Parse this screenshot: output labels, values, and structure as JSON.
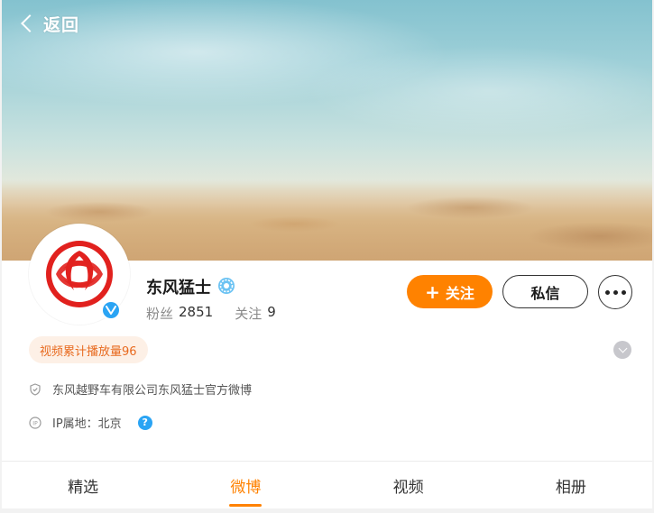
{
  "header": {
    "back_label": "返回"
  },
  "profile": {
    "name": "东风猛士",
    "stats": {
      "followers_label": "粉丝",
      "followers_value": "2851",
      "following_label": "关注",
      "following_value": "9"
    },
    "verified_mark": "V"
  },
  "actions": {
    "follow_plus": "+",
    "follow_label": "关注",
    "message_label": "私信"
  },
  "tag": {
    "text": "视频累计播放量96"
  },
  "info": {
    "verification": "东风越野车有限公司东风猛士官方微博",
    "ip_location": "IP属地：北京",
    "help_glyph": "?"
  },
  "tabs": [
    {
      "label": "精选",
      "active": false
    },
    {
      "label": "微博",
      "active": true
    },
    {
      "label": "视频",
      "active": false
    },
    {
      "label": "相册",
      "active": false
    }
  ],
  "colors": {
    "accent": "#ff8200",
    "verified_blue": "#2aa4f4",
    "tag_bg": "#fdf0e6",
    "tag_text": "#e86a1f",
    "logo_red": "#e1211e"
  }
}
